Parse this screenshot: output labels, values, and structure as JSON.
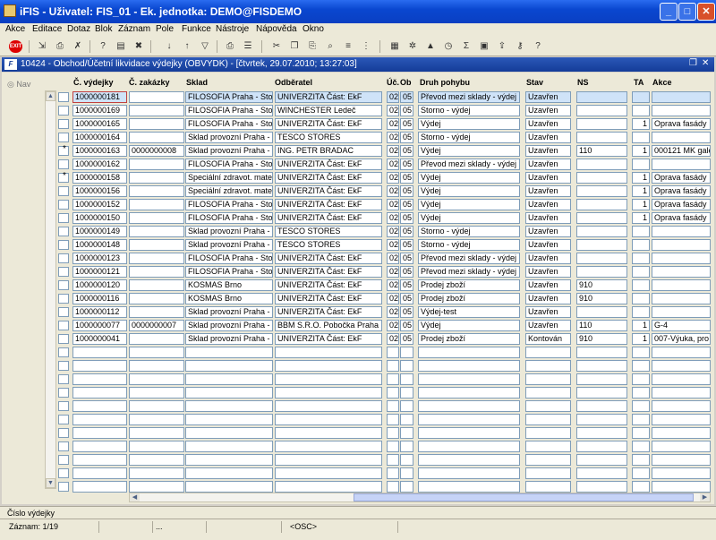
{
  "window": {
    "title": "iFIS - Uživatel: FIS_01 - Ek. jednotka: DEMO@FISDEMO"
  },
  "menu": [
    "Akce",
    "Editace",
    "Dotaz",
    "Blok",
    "Záznam",
    "Pole",
    "Funkce",
    "Nástroje",
    "Nápověda",
    "Okno"
  ],
  "toolbar": {
    "exit_label": "EXIT"
  },
  "form": {
    "title": "10424 - Obchod/Účetní likvidace výdejky (OBVYDK) - [čtvrtek, 29.07.2010; 13:27:03]",
    "nav_label": "Nav"
  },
  "columns": {
    "cislo": "Č. výdejky",
    "zakazka": "Č. zakázky",
    "sklad": "Sklad",
    "odberatel": "Odběratel",
    "ue": "Úč.",
    "ob": "Ob",
    "pohyb": "Druh pohybu",
    "stav": "Stav",
    "ns": "NS",
    "ta": "TA",
    "akce": "Akce"
  },
  "rows": [
    {
      "star": "",
      "cislo": "1000000181",
      "zakazka": "",
      "sklad": "FILOSOFIA Praha - Stor",
      "odberatel": "UNIVERZITA Část: EkF",
      "ue": "02",
      "ob": "05",
      "pohyb": "Převod mezi sklady - výdej",
      "stav": "Uzavřen",
      "ns": "",
      "ta": "",
      "akce": ""
    },
    {
      "star": "",
      "cislo": "1000000169",
      "zakazka": "",
      "sklad": "FILOSOFIA Praha - Stor",
      "odberatel": "WINCHESTER Ledeč",
      "ue": "02",
      "ob": "05",
      "pohyb": "Storno - výdej",
      "stav": "Uzavřen",
      "ns": "",
      "ta": "",
      "akce": ""
    },
    {
      "star": "",
      "cislo": "1000000165",
      "zakazka": "",
      "sklad": "FILOSOFIA Praha - Stor",
      "odberatel": "UNIVERZITA Část: EkF",
      "ue": "02",
      "ob": "05",
      "pohyb": "Výdej",
      "stav": "Uzavřen",
      "ns": "",
      "ta": "1",
      "akce": "Oprava fasády"
    },
    {
      "star": "",
      "cislo": "1000000164",
      "zakazka": "",
      "sklad": "Sklad provozní Praha -",
      "odberatel": "TESCO STORES",
      "ue": "02",
      "ob": "05",
      "pohyb": "Storno - výdej",
      "stav": "Uzavřen",
      "ns": "",
      "ta": "",
      "akce": ""
    },
    {
      "star": "*",
      "cislo": "1000000163",
      "zakazka": "0000000008",
      "sklad": "Sklad provozní Praha -",
      "odberatel": "ING. PETR BRADAC",
      "ue": "02",
      "ob": "05",
      "pohyb": "Výdej",
      "stav": "Uzavřen",
      "ns": "110",
      "ta": "1",
      "akce": "000121 MK gale"
    },
    {
      "star": "",
      "cislo": "1000000162",
      "zakazka": "",
      "sklad": "FILOSOFIA Praha - Stor",
      "odberatel": "UNIVERZITA Část: EkF",
      "ue": "02",
      "ob": "05",
      "pohyb": "Převod mezi sklady - výdej",
      "stav": "Uzavřen",
      "ns": "",
      "ta": "",
      "akce": ""
    },
    {
      "star": "*",
      "cislo": "1000000158",
      "zakazka": "",
      "sklad": "Speciální zdravot. mate",
      "odberatel": "UNIVERZITA Část: EkF",
      "ue": "02",
      "ob": "05",
      "pohyb": "Výdej",
      "stav": "Uzavřen",
      "ns": "",
      "ta": "1",
      "akce": "Oprava fasády"
    },
    {
      "star": "",
      "cislo": "1000000156",
      "zakazka": "",
      "sklad": "Speciální zdravot. mate",
      "odberatel": "UNIVERZITA Část: EkF",
      "ue": "02",
      "ob": "05",
      "pohyb": "Výdej",
      "stav": "Uzavřen",
      "ns": "",
      "ta": "1",
      "akce": "Oprava fasády"
    },
    {
      "star": "",
      "cislo": "1000000152",
      "zakazka": "",
      "sklad": "FILOSOFIA Praha - Stor",
      "odberatel": "UNIVERZITA Část: EkF",
      "ue": "02",
      "ob": "05",
      "pohyb": "Výdej",
      "stav": "Uzavřen",
      "ns": "",
      "ta": "1",
      "akce": "Oprava fasády"
    },
    {
      "star": "",
      "cislo": "1000000150",
      "zakazka": "",
      "sklad": "FILOSOFIA Praha - Stor",
      "odberatel": "UNIVERZITA Část: EkF",
      "ue": "02",
      "ob": "05",
      "pohyb": "Výdej",
      "stav": "Uzavřen",
      "ns": "",
      "ta": "1",
      "akce": "Oprava fasády"
    },
    {
      "star": "",
      "cislo": "1000000149",
      "zakazka": "",
      "sklad": "Sklad provozní Praha -",
      "odberatel": "TESCO STORES",
      "ue": "02",
      "ob": "05",
      "pohyb": "Storno - výdej",
      "stav": "Uzavřen",
      "ns": "",
      "ta": "",
      "akce": ""
    },
    {
      "star": "",
      "cislo": "1000000148",
      "zakazka": "",
      "sklad": "Sklad provozní Praha -",
      "odberatel": "TESCO STORES",
      "ue": "02",
      "ob": "05",
      "pohyb": "Storno - výdej",
      "stav": "Uzavřen",
      "ns": "",
      "ta": "",
      "akce": ""
    },
    {
      "star": "",
      "cislo": "1000000123",
      "zakazka": "",
      "sklad": "FILOSOFIA Praha - Stor",
      "odberatel": "UNIVERZITA Část: EkF",
      "ue": "02",
      "ob": "05",
      "pohyb": "Převod mezi sklady - výdej",
      "stav": "Uzavřen",
      "ns": "",
      "ta": "",
      "akce": ""
    },
    {
      "star": "",
      "cislo": "1000000121",
      "zakazka": "",
      "sklad": "FILOSOFIA Praha - Stor",
      "odberatel": "UNIVERZITA Část: EkF",
      "ue": "02",
      "ob": "05",
      "pohyb": "Převod mezi sklady - výdej",
      "stav": "Uzavřen",
      "ns": "",
      "ta": "",
      "akce": ""
    },
    {
      "star": "",
      "cislo": "1000000120",
      "zakazka": "",
      "sklad": "KOSMAS Brno",
      "odberatel": "UNIVERZITA Část: EkF",
      "ue": "02",
      "ob": "05",
      "pohyb": "Prodej zboží",
      "stav": "Uzavřen",
      "ns": "910",
      "ta": "",
      "akce": ""
    },
    {
      "star": "",
      "cislo": "1000000116",
      "zakazka": "",
      "sklad": "KOSMAS Brno",
      "odberatel": "UNIVERZITA Část: EkF",
      "ue": "02",
      "ob": "05",
      "pohyb": "Prodej zboží",
      "stav": "Uzavřen",
      "ns": "910",
      "ta": "",
      "akce": ""
    },
    {
      "star": "",
      "cislo": "1000000112",
      "zakazka": "",
      "sklad": "Sklad provozní Praha -",
      "odberatel": "UNIVERZITA Část: EkF",
      "ue": "02",
      "ob": "05",
      "pohyb": "Výdej-test",
      "stav": "Uzavřen",
      "ns": "",
      "ta": "",
      "akce": ""
    },
    {
      "star": "",
      "cislo": "1000000077",
      "zakazka": "0000000007",
      "sklad": "Sklad provozní Praha -",
      "odberatel": "BBM S.R.O. Pobočka Praha",
      "ue": "02",
      "ob": "05",
      "pohyb": "Výdej",
      "stav": "Uzavřen",
      "ns": "110",
      "ta": "1",
      "akce": "G-4"
    },
    {
      "star": "",
      "cislo": "1000000041",
      "zakazka": "",
      "sklad": "Sklad provozní Praha -",
      "odberatel": "UNIVERZITA Část: EkF",
      "ue": "02",
      "ob": "05",
      "pohyb": "Prodej zboží",
      "stav": "Kontován",
      "ns": "910",
      "ta": "1",
      "akce": "007-Výuka, pro"
    }
  ],
  "hint": "Číslo výdejky",
  "status": {
    "record": "Záznam: 1/19",
    "dots": "...",
    "osc": "<OSC>"
  }
}
